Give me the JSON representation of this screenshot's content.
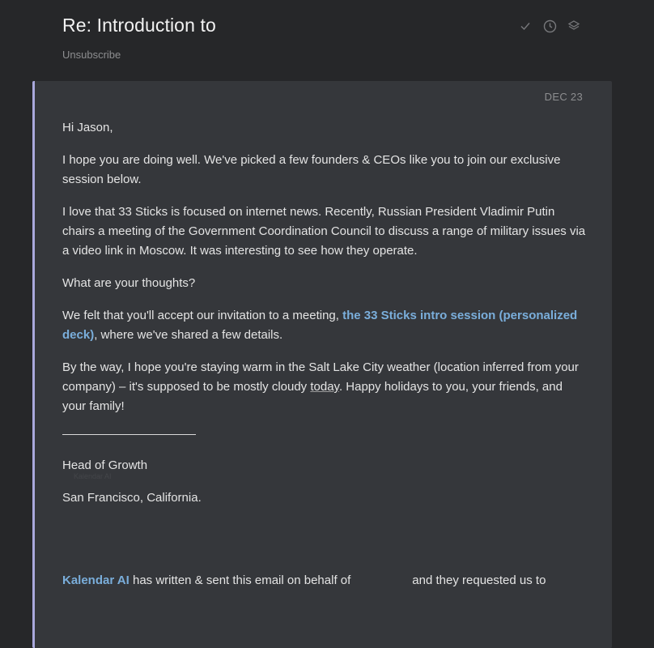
{
  "header": {
    "subject": "Re: Introduction to",
    "unsubscribe": "Unsubscribe",
    "icons": [
      "check-icon",
      "clock-icon",
      "layers-icon"
    ]
  },
  "message": {
    "date": "DEC 23",
    "greeting": "Hi Jason,",
    "para1": "I hope you are doing well. We've picked a few founders & CEOs like you to join our exclusive session below.",
    "para2": "I love that 33 Sticks is focused on internet news. Recently, Russian President Vladimir Putin chairs a meeting of the Government Coordination Council to discuss a range of military issues via a video link in Moscow. It was interesting to see how they operate.",
    "para3": "What are your thoughts?",
    "para4_before": "We felt that you'll accept our invitation to a meeting, ",
    "para4_link": "the 33 Sticks intro session (personalized deck)",
    "para4_after": ", where we've shared a few details.",
    "para5_before": "By the way, I hope you're staying warm in the Salt Lake City weather (location inferred from your company) – it's supposed to be mostly cloudy ",
    "para5_today": "today",
    "para5_after": ". Happy holidays to you, your friends, and your family!",
    "signature_title": "Head of Growth",
    "signature_ghost": "Kalendar AI",
    "signature_location": "San Francisco, California.",
    "footer_link": "Kalendar AI",
    "footer_text1": " has written & sent this email on behalf of",
    "footer_text2": "and they requested us to"
  },
  "colors": {
    "background": "#262729",
    "card": "#35373b",
    "accent_border": "#a9a8dc",
    "link": "#7aaedb"
  }
}
